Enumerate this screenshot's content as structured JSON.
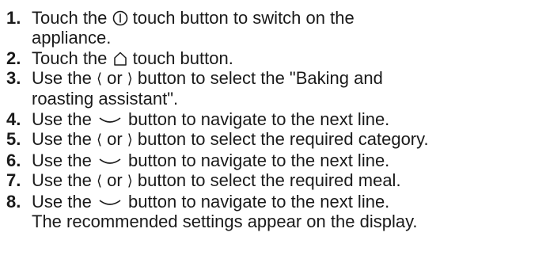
{
  "steps": [
    {
      "num": "1.",
      "parts": [
        "Touch the ",
        " touch button to switch on the"
      ],
      "cont": "appliance.",
      "icon": "power-icon"
    },
    {
      "num": "2.",
      "parts": [
        "Touch the ",
        " touch button."
      ],
      "icon": "home-icon"
    },
    {
      "num": "3.",
      "parts": [
        "Use the ",
        " or ",
        " button to select the \"Baking and"
      ],
      "cont": "roasting assistant\".",
      "icons": [
        "chevron-left-icon",
        "chevron-right-icon"
      ]
    },
    {
      "num": "4.",
      "parts": [
        "Use the ",
        " button to navigate to the next line."
      ],
      "icon": "chevron-down-icon"
    },
    {
      "num": "5.",
      "parts": [
        "Use the ",
        " or ",
        " button to select the required category."
      ],
      "icons": [
        "chevron-left-icon",
        "chevron-right-icon"
      ]
    },
    {
      "num": "6.",
      "parts": [
        "Use the ",
        " button to navigate to the next line."
      ],
      "icon": "chevron-down-icon"
    },
    {
      "num": "7.",
      "parts": [
        "Use the ",
        " or ",
        " button to select the required meal."
      ],
      "icons": [
        "chevron-left-icon",
        "chevron-right-icon"
      ]
    },
    {
      "num": "8.",
      "parts": [
        "Use the ",
        " button to navigate to the next line."
      ],
      "cont": "The recommended settings appear on the display.",
      "icon": "chevron-down-icon"
    }
  ],
  "glyphs": {
    "left": "⟨",
    "right": "⟩"
  }
}
